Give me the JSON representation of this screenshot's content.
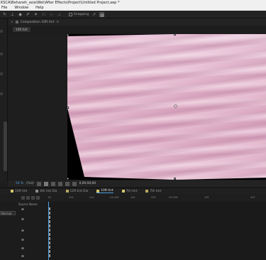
{
  "window": {
    "title": "KSCA\\Behaneh_asia\\Wet\\After Effects\\Project\\Untitled Project.aep *"
  },
  "menu": [
    "File",
    "Window",
    "Help"
  ],
  "toolbar": {
    "snapping_label": "Snapping"
  },
  "composition_panel": {
    "tab_label": "Composition 10ft tint",
    "breadcrumb": "10ft tint"
  },
  "viewer_controls": {
    "zoom": "50 %",
    "resolution": "(Full)",
    "timecode": "0;00;00;00"
  },
  "timeline": {
    "tabs": [
      {
        "label": "10ft tint",
        "color": "#d6c76a"
      },
      {
        "label": "4th tint Dia",
        "color": "#8a8a8a"
      },
      {
        "label": "12ft tint Dia",
        "color": "#b9a860"
      },
      {
        "label": "10ft tint",
        "color": "#d6c76a",
        "active": true
      },
      {
        "label": "7th tint",
        "color": "#d6c76a"
      },
      {
        "label": "7th tint",
        "color": "#b9a860"
      }
    ],
    "layer_header": "Source Name",
    "mode_dropdown": "Normal",
    "ruler_ticks": [
      "0f",
      "10f",
      "20f",
      "01:00f",
      "10f",
      "20f",
      "02:00f",
      "10f",
      "20f"
    ],
    "current_time_fraction": 0.0,
    "work_area_fraction": 0.065
  },
  "colors": {
    "accent_blue": "#4a9ee0",
    "work_area_green": "#3fae4b",
    "fabric_pink": "#e4b6cc"
  }
}
